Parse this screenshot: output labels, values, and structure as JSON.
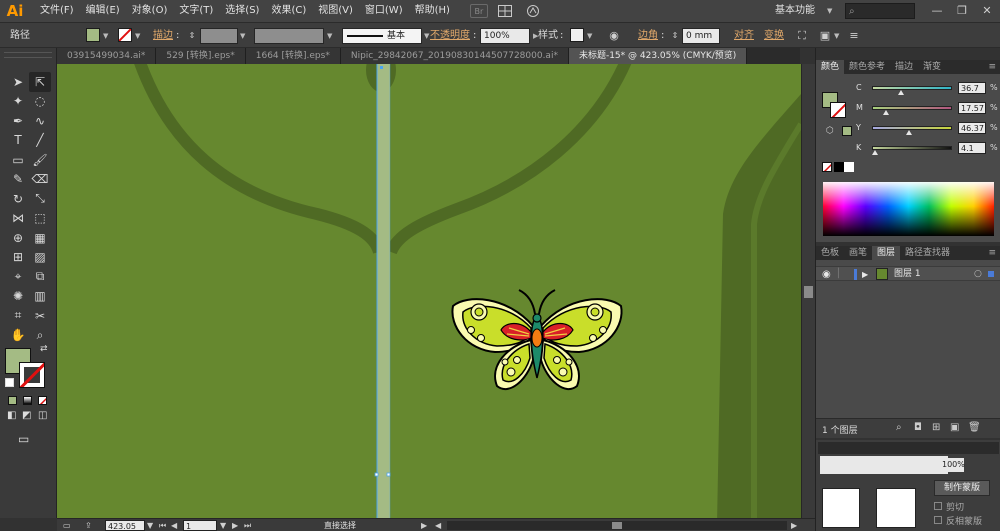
{
  "app": {
    "logo": "Ai",
    "accent": "#ff9a00"
  },
  "menu": [
    "文件(F)",
    "编辑(E)",
    "对象(O)",
    "文字(T)",
    "选择(S)",
    "效果(C)",
    "视图(V)",
    "窗口(W)",
    "帮助(H)"
  ],
  "menubar_icons": {
    "bridge": "Br"
  },
  "workspace": {
    "label": "基本功能"
  },
  "window_controls": {
    "minimize": "—",
    "restore": "❐",
    "close": "✕"
  },
  "control_bar": {
    "object_type": "路径",
    "fill_color": "#a4bb84",
    "stroke_label": "描边",
    "stroke_profile": "基本",
    "opacity_label": "不透明度",
    "opacity_value": "100%",
    "style_label": "样式",
    "corner_label": "边角",
    "corner_value": "0 mm",
    "align_label": "对齐",
    "transform_label": "变换"
  },
  "tabs": [
    {
      "label": "03915499034.ai*",
      "active": false
    },
    {
      "label": "529 [转换].eps*",
      "active": false
    },
    {
      "label": "1664 [转换].eps*",
      "active": false
    },
    {
      "label": "Nipic_29842067_20190830144507728000.ai*",
      "active": false
    },
    {
      "label": "未标题-15* @ 423.05% (CMYK/预览)",
      "active": true
    }
  ],
  "tools": [
    "selection-tool",
    "direct-selection-tool",
    "magic-wand-tool",
    "lasso-tool",
    "pen-tool",
    "curvature-tool",
    "type-tool",
    "line-segment-tool",
    "rectangle-tool",
    "paintbrush-tool",
    "pencil-tool",
    "eraser-tool",
    "rotate-tool",
    "scale-tool",
    "width-tool",
    "free-transform-tool",
    "shape-builder-tool",
    "perspective-grid-tool",
    "mesh-tool",
    "gradient-tool",
    "eyedropper-tool",
    "blend-tool",
    "symbol-sprayer-tool",
    "column-graph-tool",
    "artboard-tool",
    "slice-tool",
    "hand-tool",
    "zoom-tool"
  ],
  "tools_panel": {
    "fill_color": "#a4bb84"
  },
  "canvas": {
    "background": "#66882f",
    "dark_stroke": "#4f6a24",
    "stem_color": "#a4bb84",
    "butterfly": {
      "outline": "#000000",
      "wing_fill": "#fafbb0",
      "wing_inner": "#c9de2a",
      "red_pattern": "#d92028",
      "orange_spot": "#f27c12",
      "body_teal": "#1d8a6a"
    }
  },
  "status_bar": {
    "zoom": "423.05",
    "page": "1",
    "tool_name": "直接选择"
  },
  "color_panel": {
    "tabs": [
      {
        "label": "颜色",
        "active": true
      },
      {
        "label": "颜色参考",
        "active": false
      },
      {
        "label": "描边",
        "active": false
      },
      {
        "label": "渐变",
        "active": false
      }
    ],
    "fill_color": "#a4bb84",
    "channels": [
      {
        "letter": "C",
        "value": "36.7",
        "position": 0.367,
        "gradient": "linear-gradient(to right,#c5d8a0,#2fb4c8)"
      },
      {
        "letter": "M",
        "value": "17.57",
        "position": 0.1757,
        "gradient": "linear-gradient(to right,#a7d07c,#b3557f)"
      },
      {
        "letter": "Y",
        "value": "46.37",
        "position": 0.4637,
        "gradient": "linear-gradient(to right,#a4a6e2,#c8d63a)"
      },
      {
        "letter": "K",
        "value": "4.1",
        "position": 0.041,
        "gradient": "linear-gradient(to right,#c3d59b,#111111)"
      }
    ],
    "percent_sign": "%"
  },
  "layers_panel": {
    "tabs": [
      {
        "label": "色板",
        "active": false
      },
      {
        "label": "画笔",
        "active": false
      },
      {
        "label": "图层",
        "active": true
      },
      {
        "label": "路径查找器",
        "active": false
      }
    ],
    "layer_name": "图层 1",
    "layer_count": "1 个图层"
  },
  "transparency_panel": {
    "opacity": "100%",
    "make_mask_button": "制作蒙版",
    "clip_label": "剪切",
    "invert_mask_label": "反相蒙版"
  }
}
